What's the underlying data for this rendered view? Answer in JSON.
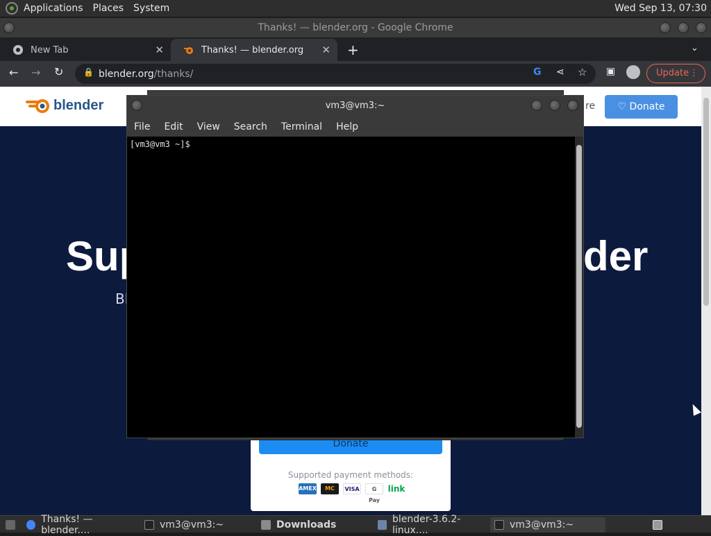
{
  "top_panel": {
    "menus": [
      "Applications",
      "Places",
      "System"
    ],
    "clock": "Wed Sep 13, 07:30"
  },
  "chrome": {
    "window_title": "Thanks! — blender.org - Google Chrome",
    "tabs": [
      {
        "label": "New Tab"
      },
      {
        "label": "Thanks! — blender.org"
      }
    ],
    "url_host": "blender.org",
    "url_path": "/thanks/",
    "update_label": "Update"
  },
  "page": {
    "logo_text": "blender",
    "header_partial_text": "re",
    "donate_header": "Donate",
    "hero_left": "Sup",
    "hero_right": "der",
    "hero_sub": "Bl",
    "card_donate": "Donate",
    "payment_label": "Supported payment methods:",
    "payment_methods": [
      "AMEX",
      "MC",
      "VISA",
      "G Pay",
      "link"
    ]
  },
  "terminal": {
    "title": "vm3@vm3:~",
    "menu": [
      "File",
      "Edit",
      "View",
      "Search",
      "Terminal",
      "Help"
    ],
    "prompt": "[vm3@vm3 ~]$"
  },
  "taskbar": {
    "items": [
      "Thanks! — blender....",
      "vm3@vm3:~",
      "Downloads",
      "blender-3.6.2-linux....",
      "vm3@vm3:~"
    ]
  },
  "colors": {
    "accent_blue": "#4a90e2",
    "update_red": "#e8685b",
    "page_bg": "#0c1a3d",
    "blender_orange": "#e87d0d"
  }
}
